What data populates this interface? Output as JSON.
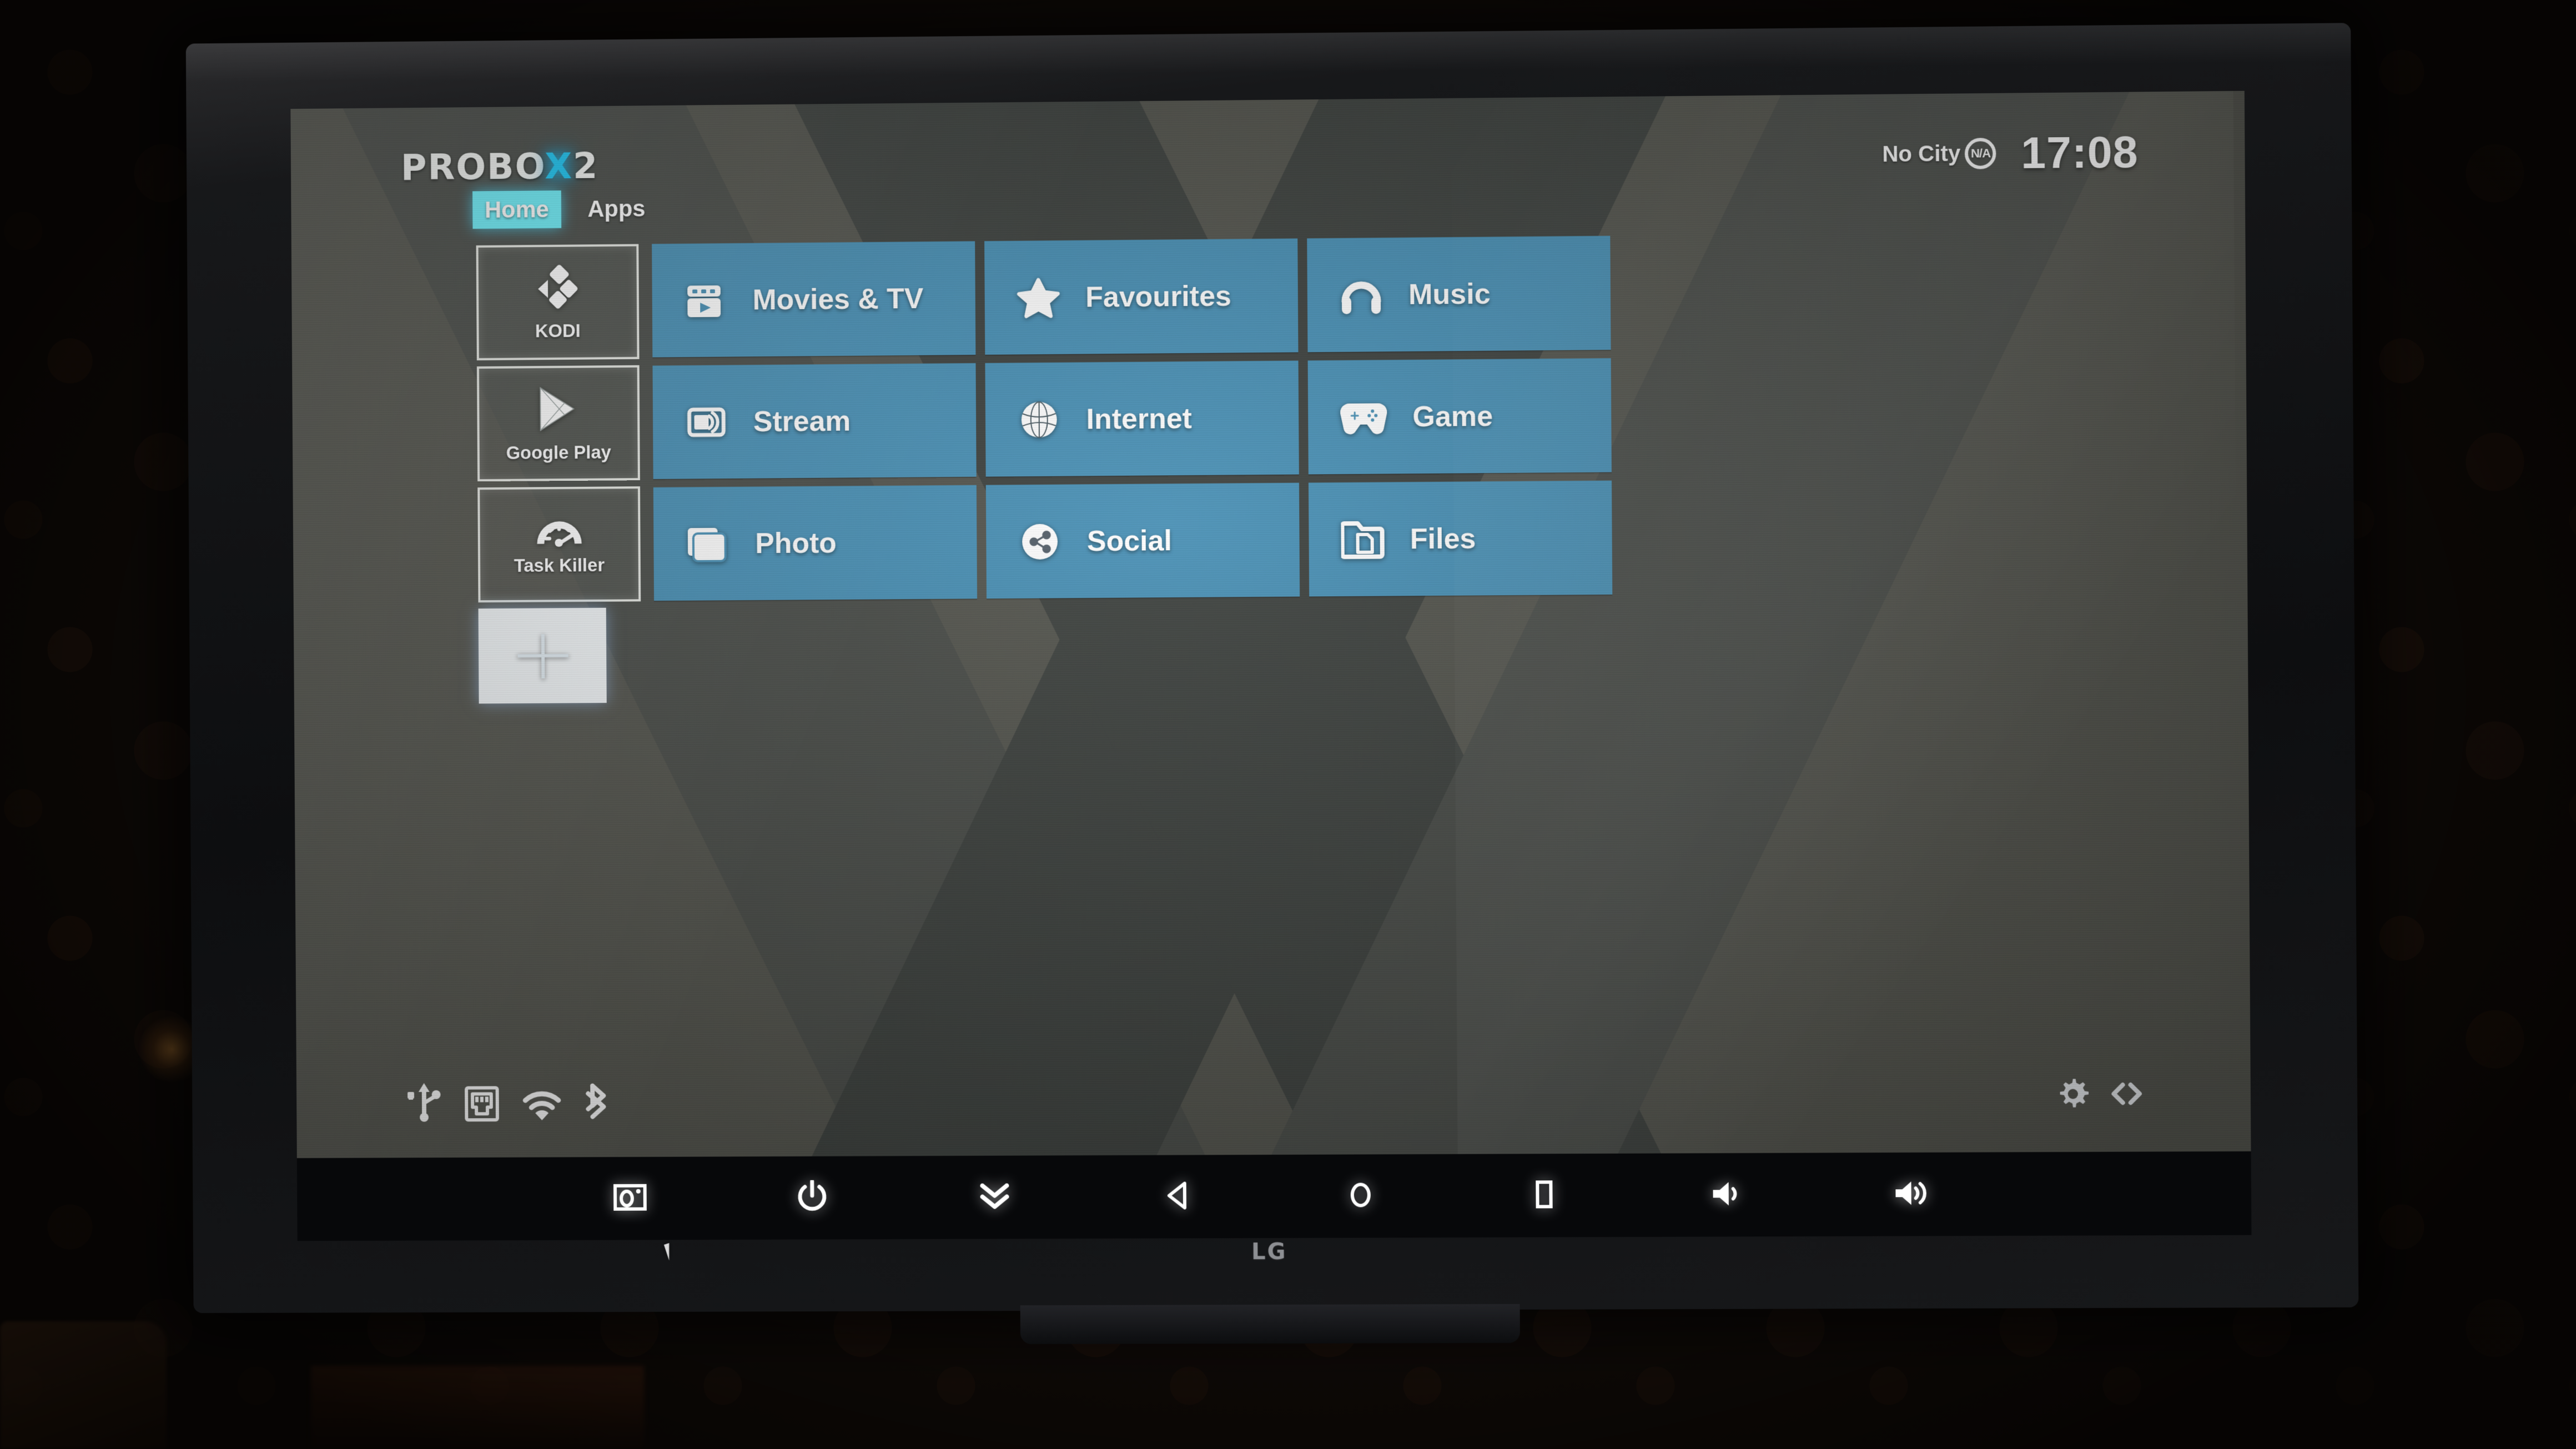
{
  "brand": {
    "logo_prefix": "PROBO",
    "logo_x": "X",
    "logo_suffix": "2",
    "tv_brand": "LG"
  },
  "colors": {
    "tile_blue": "#4a91b6",
    "accent_cyan": "#6ff0fb",
    "logo_x_cyan": "#1fc8f5",
    "screen_bg": "#55564f",
    "x_pattern": "#3f4340",
    "navbar_bg": "#07080a"
  },
  "statusbar": {
    "city": "No City",
    "weather_badge": "N/A",
    "clock": "17:08"
  },
  "tabs": [
    {
      "label": "Home",
      "active": true
    },
    {
      "label": "Apps",
      "active": false
    }
  ],
  "app_column": [
    {
      "label": "KODI",
      "icon": "kodi-icon"
    },
    {
      "label": "Google Play",
      "icon": "google-play-icon"
    },
    {
      "label": "Task Killer",
      "icon": "gauge-icon"
    },
    {
      "label": "",
      "icon": "blank-app-icon"
    }
  ],
  "grid": [
    {
      "label": "Movies & TV",
      "icon": "film-play-icon"
    },
    {
      "label": "Favourites",
      "icon": "star-icon"
    },
    {
      "label": "Music",
      "icon": "headphones-icon"
    },
    {
      "label": "Stream",
      "icon": "cast-icon"
    },
    {
      "label": "Internet",
      "icon": "globe-icon"
    },
    {
      "label": "Game",
      "icon": "gamepad-icon"
    },
    {
      "label": "Photo",
      "icon": "photos-icon"
    },
    {
      "label": "Social",
      "icon": "share-icon"
    },
    {
      "label": "Files",
      "icon": "folder-file-icon"
    }
  ],
  "system_status": [
    {
      "name": "usb-icon"
    },
    {
      "name": "ethernet-icon"
    },
    {
      "name": "wifi-icon"
    },
    {
      "name": "bluetooth-icon"
    }
  ],
  "system_actions": [
    {
      "name": "gear-icon"
    },
    {
      "name": "code-icon"
    }
  ],
  "navbar": [
    {
      "name": "screenshot-icon"
    },
    {
      "name": "power-icon"
    },
    {
      "name": "notifications-icon"
    },
    {
      "name": "back-icon"
    },
    {
      "name": "home-icon"
    },
    {
      "name": "recents-icon"
    },
    {
      "name": "volume-down-icon"
    },
    {
      "name": "volume-up-icon"
    }
  ]
}
